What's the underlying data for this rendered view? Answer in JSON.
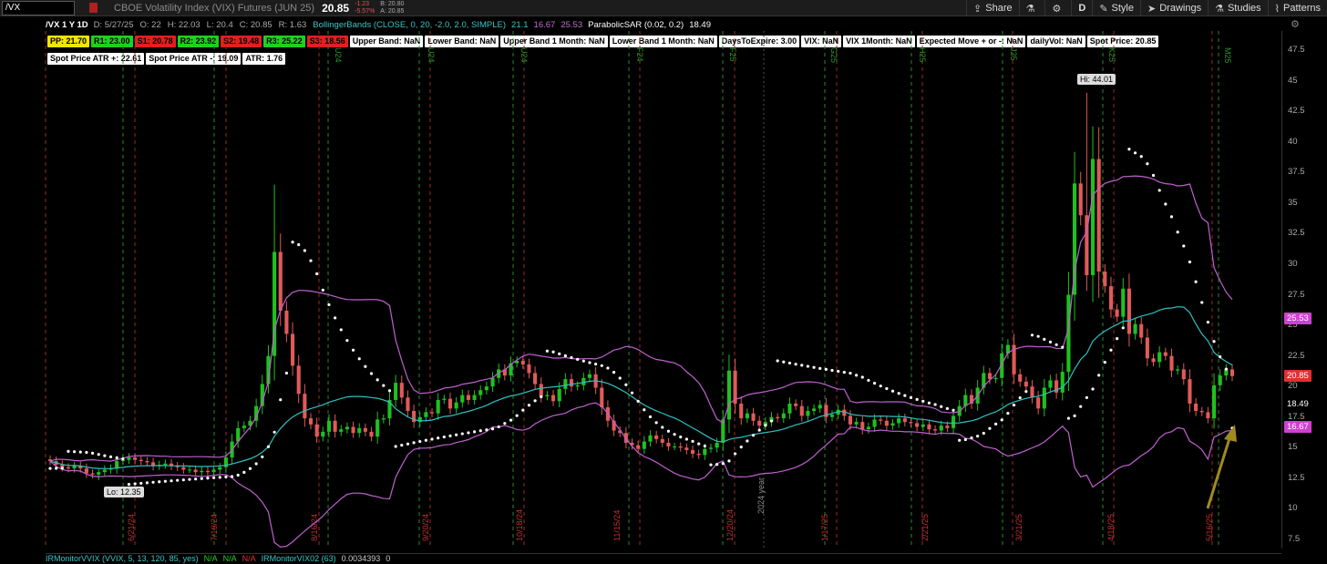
{
  "toolbar": {
    "symbol": "/VX",
    "description": "CBOE Volatility Index (VIX) Futures (JUN 25)",
    "last": "20.85",
    "change": "-1.23",
    "change_pct": "-5.57%",
    "bid": "B: 20.80",
    "ask": "A: 20.85",
    "share": "Share",
    "period": "D",
    "style": "Style",
    "drawings": "Drawings",
    "studies": "Studies",
    "patterns": "Patterns"
  },
  "header": {
    "symbol": "/VX 1 Y 1D",
    "date": "D: 5/27/25",
    "open": "O: 22",
    "high": "H: 22.03",
    "low": "L: 20.4",
    "close": "C: 20.85",
    "range": "R: 1.63",
    "bb_study": "BollingerBands (CLOSE, 0, 20, -2.0, 2.0, SIMPLE)",
    "bb_mid": "21.1",
    "bb_low": "16.67",
    "bb_up": "25.53",
    "sar_study": "ParabolicSAR (0.02, 0.2)",
    "sar_val": "18.49"
  },
  "pivot_labels": [
    {
      "text": "PP: 21.70",
      "color": "yel"
    },
    {
      "text": "R1: 23.00",
      "color": "grn"
    },
    {
      "text": "S1: 20.78",
      "color": "red"
    },
    {
      "text": "R2: 23.92",
      "color": "grn"
    },
    {
      "text": "S2: 19.48",
      "color": "red"
    },
    {
      "text": "R3: 25.22",
      "color": "grn"
    },
    {
      "text": "S3: 18.56",
      "color": "red"
    },
    {
      "text": "Upper Band: NaN",
      "color": "wht"
    },
    {
      "text": "Lower Band: NaN",
      "color": "wht"
    },
    {
      "text": "Upper Band 1 Month: NaN",
      "color": "wht"
    },
    {
      "text": "Lower Band 1 Month: NaN",
      "color": "wht"
    },
    {
      "text": "DaysToExpire: 3.00",
      "color": "wht"
    },
    {
      "text": "VIX: NaN",
      "color": "wht"
    },
    {
      "text": "VIX 1Month: NaN",
      "color": "wht"
    },
    {
      "text": "Expected Move + or -: NaN",
      "color": "wht"
    },
    {
      "text": "dailyVol: NaN",
      "color": "wht"
    },
    {
      "text": "Spot Price: 20.85",
      "color": "wht"
    }
  ],
  "atr_labels": [
    {
      "text": "Spot Price ATR +: 22.61"
    },
    {
      "text": "Spot Price ATR -: 19.09"
    },
    {
      "text": "ATR: 1.76"
    }
  ],
  "price_axis": [
    "47.5",
    "45",
    "42.5",
    "40",
    "37.5",
    "35",
    "32.5",
    "30",
    "27.5",
    "25",
    "22.5",
    "20",
    "17.5",
    "15",
    "12.5",
    "10",
    "7.5"
  ],
  "price_badges": [
    {
      "text": "25.53",
      "value": 25.53,
      "bg": "#d040d0",
      "fg": "#fff"
    },
    {
      "text": "20.85",
      "value": 20.85,
      "bg": "#e03030",
      "fg": "#fff"
    },
    {
      "text": "18.49",
      "value": 18.49,
      "bg": "#000",
      "fg": "#fff"
    },
    {
      "text": "16.67",
      "value": 16.67,
      "bg": "#d040d0",
      "fg": "#fff"
    }
  ],
  "annotations": {
    "high": "Hi: 44.01",
    "low": "Lo: 12.35"
  },
  "date_labels": [
    "6/21/24",
    "7/19/24",
    "8/16/24",
    "9/20/24",
    "10/18/24",
    "11/15/24",
    "12/20/24",
    "2024 year",
    "1/17/25",
    "2/21/25",
    "3/21/25",
    "4/18/25",
    "5/16/25"
  ],
  "top_markers": [
    "U24",
    "U24",
    "U24",
    "F24",
    "F25",
    "G25",
    "H25",
    "J25",
    "K25",
    "M25"
  ],
  "study_bar": {
    "name": "IRMonitorVVIX (VVIX, 5, 13, 120, 85, yes)",
    "v1": "N/A",
    "v2": "N/A",
    "v3": "N/A",
    "name2": "IRMonitorVIX02 (63)",
    "v4": "0.0034393",
    "v5": "0"
  },
  "colors": {
    "up": "#20c020",
    "down": "#e05a5a",
    "bb": "#c060d0",
    "mid": "#30c0c0",
    "sar": "#ffffff",
    "arrow": "#a08a20"
  },
  "chart_data": {
    "type": "candlestick",
    "closes": [
      13.9,
      13.6,
      13.4,
      13.3,
      13.5,
      13.3,
      12.9,
      12.8,
      13.0,
      13.2,
      13.3,
      13.9,
      14.0,
      14.2,
      14.0,
      13.9,
      13.8,
      13.5,
      13.6,
      13.7,
      13.5,
      13.4,
      13.2,
      13.2,
      13.0,
      13.1,
      13.0,
      13.2,
      13.4,
      14.2,
      15.5,
      16.6,
      16.8,
      17.2,
      18.4,
      20.2,
      22.5,
      31.0,
      26.2,
      24.3,
      21.7,
      19.4,
      17.4,
      16.9,
      15.9,
      16.3,
      17.2,
      16.3,
      16.5,
      16.7,
      16.2,
      16.6,
      16.3,
      15.9,
      17.3,
      17.4,
      18.9,
      20.3,
      19.1,
      18.0,
      17.1,
      17.5,
      17.9,
      17.8,
      18.9,
      19.0,
      18.2,
      18.7,
      19.3,
      18.9,
      19.3,
      19.7,
      20.0,
      20.7,
      21.4,
      20.9,
      21.9,
      22.1,
      21.8,
      21.1,
      20.2,
      19.2,
      19.3,
      18.8,
      19.8,
      20.6,
      20.0,
      20.1,
      20.7,
      21.0,
      19.9,
      18.3,
      17.2,
      16.4,
      16.2,
      15.4,
      15.2,
      14.9,
      15.5,
      16.0,
      15.7,
      15.4,
      15.1,
      15.1,
      15.0,
      14.8,
      14.5,
      14.4,
      14.9,
      15.0,
      15.4,
      17.3,
      21.3,
      18.6,
      17.4,
      17.8,
      17.2,
      16.8,
      17.1,
      17.5,
      17.4,
      17.8,
      18.6,
      18.4,
      17.6,
      18.0,
      18.2,
      18.5,
      17.5,
      17.7,
      18.1,
      17.6,
      16.9,
      17.1,
      16.5,
      16.7,
      17.3,
      17.2,
      16.8,
      17.0,
      17.4,
      17.1,
      17.0,
      16.7,
      16.9,
      16.5,
      16.4,
      16.8,
      16.6,
      17.6,
      18.4,
      19.3,
      18.6,
      19.9,
      21.1,
      20.6,
      20.7,
      22.7,
      23.4,
      21.0,
      20.4,
      20.0,
      19.1,
      18.2,
      19.9,
      20.5,
      19.5,
      21.2,
      27.5,
      36.6,
      34.0,
      29.1,
      38.6,
      29.4,
      28.2,
      26.3,
      25.7,
      28.0,
      24.3,
      25.1,
      24.0,
      22.3,
      22.0,
      22.8,
      22.5,
      21.3,
      21.4,
      20.6,
      18.6,
      18.0,
      17.9,
      17.4,
      20.1,
      20.9,
      21.4,
      20.85
    ],
    "bb_upper": 25.53,
    "bb_mid": 21.1,
    "bb_lower": 16.67,
    "sar_last": 18.49,
    "high": 44.01,
    "low": 12.35,
    "ylim": [
      7.5,
      47.5
    ]
  }
}
